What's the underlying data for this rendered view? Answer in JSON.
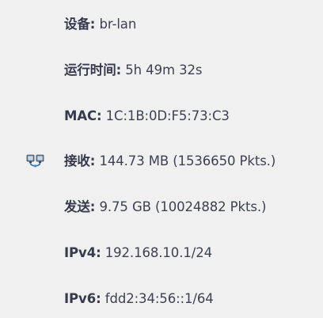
{
  "interface": {
    "device": {
      "label": "设备:",
      "value": "br-lan"
    },
    "uptime": {
      "label": "运行时间:",
      "value": "5h 49m 32s"
    },
    "mac": {
      "label": "MAC:",
      "value": "1C:1B:0D:F5:73:C3"
    },
    "rx": {
      "label": "接收:",
      "value": "144.73 MB (1536650 Pkts.)"
    },
    "tx": {
      "label": "发送:",
      "value": "9.75 GB (10024882 Pkts.)"
    },
    "ipv4": {
      "label": "IPv4:",
      "value": "192.168.10.1/24"
    },
    "ipv6": {
      "label": "IPv6:",
      "value": "fdd2:34:56::1/64"
    },
    "icon": "network-bridge-icon"
  }
}
